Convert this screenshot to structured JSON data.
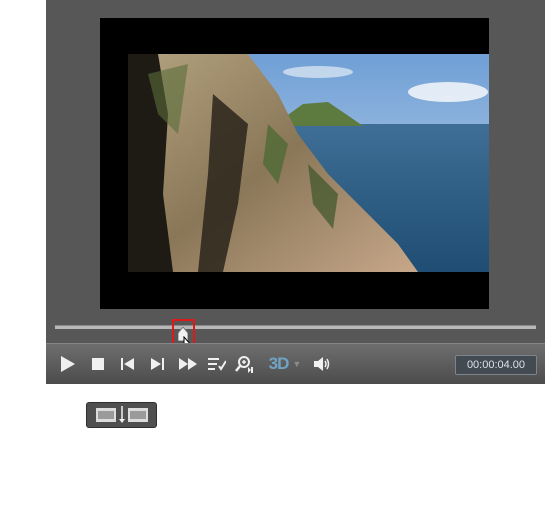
{
  "player": {
    "timecode": "00:00:04.00",
    "three_d_label": "3D",
    "seek_progress_fraction": 0.27
  },
  "icons": {
    "play": "play-icon",
    "stop": "stop-icon",
    "previous_frame": "previous-frame-icon",
    "next_frame": "next-frame-icon",
    "fast_forward": "fast-forward-icon",
    "playlist": "playlist-icon",
    "zoom": "zoom-icon",
    "volume": "volume-icon",
    "split": "split-clip-icon"
  },
  "colors": {
    "highlight": "#e01818",
    "three_d": "#6fa3c4"
  }
}
